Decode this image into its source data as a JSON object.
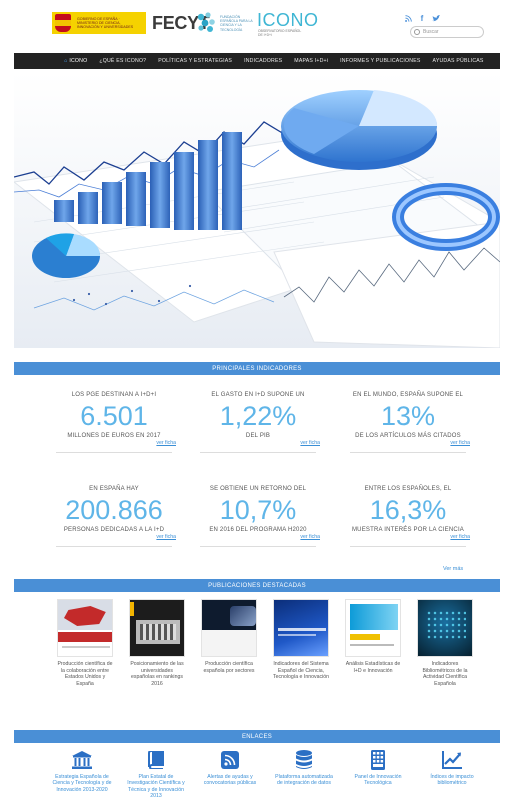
{
  "header": {
    "gob_text": "GOBIERNO DE ESPAÑA · MINISTERIO DE CIENCIA, INNOVACIÓN Y UNIVERSIDADES",
    "fecyt": "FECYT",
    "fecyt_sub": "FUNDACIÓN ESPAÑOLA PARA LA CIENCIA Y LA TECNOLOGÍA",
    "icono": "ICONO",
    "icono_sub": "OBSERVATORIO ESPAÑOL DE I+D+i",
    "search_placeholder": "Buscar"
  },
  "nav": {
    "items": [
      {
        "label": "ICONO"
      },
      {
        "label": "¿QUÉ ES ICONO?"
      },
      {
        "label": "POLÍTICAS Y ESTRATEGIAS"
      },
      {
        "label": "INDICADORES"
      },
      {
        "label": "MAPAS I+D+i"
      },
      {
        "label": "INFORMES Y PUBLICACIONES"
      },
      {
        "label": "AYUDAS PÚBLICAS"
      }
    ]
  },
  "indicators": {
    "title": "PRINCIPALES INDICADORES",
    "link_label": "ver ficha",
    "more": "Ver más",
    "items": [
      {
        "top": "LOS PGE DESTINAN A I+D+I",
        "value": "6.501",
        "bottom": "MILLONES DE EUROS EN 2017"
      },
      {
        "top": "EL GASTO EN I+D SUPONE UN",
        "value": "1,22%",
        "bottom": "DEL PIB"
      },
      {
        "top": "EN EL MUNDO, ESPAÑA SUPONE EL",
        "value": "13%",
        "bottom": "DE LOS ARTÍCULOS MÁS CITADOS"
      },
      {
        "top": "EN ESPAÑA HAY",
        "value": "200.866",
        "bottom": "PERSONAS DEDICADAS A LA I+D"
      },
      {
        "top": "SE OBTIENE UN RETORNO DEL",
        "value": "10,7%",
        "bottom": "EN 2016 DEL PROGRAMA H2020"
      },
      {
        "top": "ENTRE LOS ESPAÑOLES, EL",
        "value": "16,3%",
        "bottom": "MUESTRA INTERÉS POR LA CIENCIA"
      }
    ]
  },
  "publications": {
    "title": "PUBLICACIONES DESTACADAS",
    "items": [
      {
        "caption": "Producción científica de la colaboración entre Estados Unidos y España"
      },
      {
        "caption": "Posicionamiento de las universidades españolas en rankings 2016"
      },
      {
        "caption": "Producción científica española por sectores"
      },
      {
        "caption": "Indicadores del Sistema Español de Ciencia, Tecnología e Innovación"
      },
      {
        "caption": "Análisis Estadísticas de I+D e Innovación"
      },
      {
        "caption": "Indicadores Bibliométricos de la Actividad Científica Española"
      }
    ]
  },
  "links": {
    "title": "ENLACES",
    "items": [
      {
        "caption": "Estrategia Española de Ciencia y Tecnología y de Innovación 2013-2020",
        "icon": "institution-icon"
      },
      {
        "caption": "Plan Estatal de Investigación Científica y Técnica y de Innovación 2013",
        "icon": "book-icon"
      },
      {
        "caption": "Alertas de ayudas y convocatorias públicas",
        "icon": "rss-icon"
      },
      {
        "caption": "Plataforma automatizada de integración de datos",
        "icon": "database-icon"
      },
      {
        "caption": "Panel de Innovación Tecnológica",
        "icon": "panel-icon"
      },
      {
        "caption": "Índices de impacto bibliométrico",
        "icon": "chart-icon"
      }
    ]
  },
  "colors": {
    "accent": "#4a8fd6",
    "big_number": "#5fb5e8",
    "nav_bg": "#222222"
  }
}
